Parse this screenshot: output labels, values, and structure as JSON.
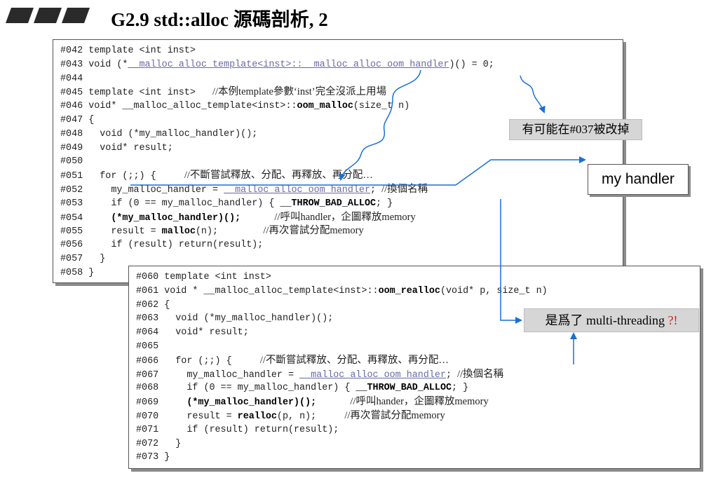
{
  "title": "G2.9 std::alloc 源碼剖析, 2",
  "code_block_1": {
    "lines": [
      {
        "num": "#042",
        "text": "template <int inst>"
      },
      {
        "num": "#043",
        "pre": "void (*",
        "mid": "__malloc_alloc_template<inst>::__malloc_alloc_oom_handler",
        "post": ")() = 0;"
      },
      {
        "num": "#044",
        "text": ""
      },
      {
        "num": "#045",
        "text": "template <int inst>   ",
        "comment": "//本例template參數‘inst’完全沒派上用場"
      },
      {
        "num": "#046",
        "pre": "void* __malloc_alloc_template<inst>::",
        "bold": "oom_malloc",
        "post": "(size_t n)"
      },
      {
        "num": "#047",
        "text": "{"
      },
      {
        "num": "#048",
        "text": "  void (*my_malloc_handler)();"
      },
      {
        "num": "#049",
        "text": "  void* result;"
      },
      {
        "num": "#050",
        "text": ""
      },
      {
        "num": "#051",
        "text": "  for (;;) {     ",
        "comment": "//不斷嘗試釋放、分配、再釋放、再分配…"
      },
      {
        "num": "#052",
        "pre": "    my_malloc_handler = ",
        "mid": "__malloc_alloc_oom_handler",
        "post": "; ",
        "comment": "//換個名稱"
      },
      {
        "num": "#053",
        "pre": "    if (0 == my_malloc_handler) { ",
        "bold": "__THROW_BAD_ALLOC",
        "post": "; }"
      },
      {
        "num": "#054",
        "bold": "    (*my_malloc_handler)();",
        "post": "      ",
        "comment": "//呼叫handler，企圖釋放memory"
      },
      {
        "num": "#055",
        "pre": "    result = ",
        "bold": "malloc",
        "post": "(n);        ",
        "comment": "//再次嘗試分配memory"
      },
      {
        "num": "#056",
        "text": "    if (result) return(result);"
      },
      {
        "num": "#057",
        "text": "  }"
      },
      {
        "num": "#058",
        "text": "}"
      }
    ]
  },
  "code_block_2": {
    "lines": [
      {
        "num": "#060",
        "text": "template <int inst>"
      },
      {
        "num": "#061",
        "pre": "void * __malloc_alloc_template<inst>::",
        "bold": "oom_realloc",
        "post": "(void* p, size_t n)"
      },
      {
        "num": "#062",
        "text": "{"
      },
      {
        "num": "#063",
        "text": "  void (*my_malloc_handler)();"
      },
      {
        "num": "#064",
        "text": "  void* result;"
      },
      {
        "num": "#065",
        "text": ""
      },
      {
        "num": "#066",
        "text": "  for (;;) {     ",
        "comment": "//不斷嘗試釋放、分配、再釋放、再分配…"
      },
      {
        "num": "#067",
        "pre": "    my_malloc_handler = ",
        "mid": "__malloc_alloc_oom_handler",
        "post": "; ",
        "comment": "//換個名稱"
      },
      {
        "num": "#068",
        "pre": "    if (0 == my_malloc_handler) { ",
        "bold": "__THROW_BAD_ALLOC",
        "post": "; }"
      },
      {
        "num": "#069",
        "bold": "    (*my_malloc_handler)();",
        "post": "      ",
        "comment": "//呼叫hander，企圖釋放memory"
      },
      {
        "num": "#070",
        "pre": "    result = ",
        "bold": "realloc",
        "post": "(p, n);     ",
        "comment": "//再次嘗試分配memory"
      },
      {
        "num": "#071",
        "text": "    if (result) return(result);"
      },
      {
        "num": "#072",
        "text": "  }"
      },
      {
        "num": "#073",
        "text": "}"
      }
    ]
  },
  "callouts": {
    "may_change": "有可能在#037被改掉",
    "my_handler": "my handler",
    "multithreading_prefix": "是爲了 multi-threading ",
    "multithreading_suffix": "?!"
  },
  "colors": {
    "arrow_blue": "#1a6fd6",
    "callout_gray": "#d6d6d6",
    "question_red": "#d42020"
  }
}
